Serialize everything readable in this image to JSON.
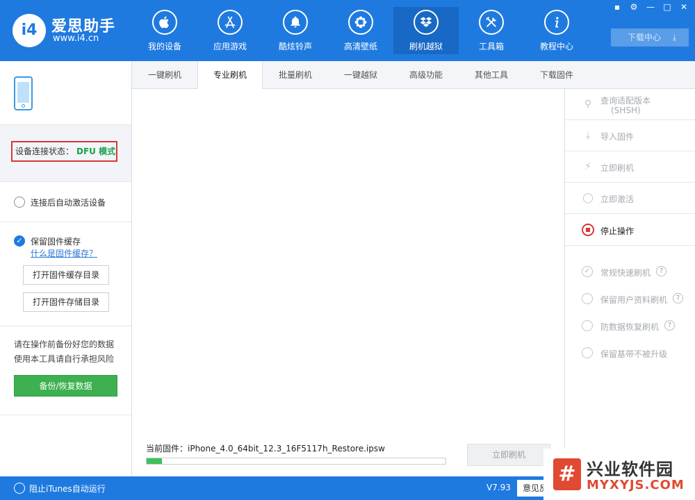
{
  "app": {
    "logo_mark": "i4",
    "title": "爱思助手",
    "url": "www.i4.cn"
  },
  "nav": [
    {
      "label": "我的设备",
      "icon": "apple-icon"
    },
    {
      "label": "应用游戏",
      "icon": "app-store-icon"
    },
    {
      "label": "酷炫铃声",
      "icon": "bell-icon"
    },
    {
      "label": "高清壁纸",
      "icon": "flower-icon"
    },
    {
      "label": "刷机越狱",
      "icon": "dropbox-icon",
      "active": true
    },
    {
      "label": "工具箱",
      "icon": "tools-icon"
    },
    {
      "label": "教程中心",
      "icon": "info-icon"
    }
  ],
  "window": {
    "download_center": "下载中心"
  },
  "left": {
    "status_label": "设备连接状态：",
    "status_value": "DFU 模式",
    "auto_activate": "连接后自动激活设备",
    "keep_cache": "保留固件缓存",
    "what_is_cache": "什么是固件缓存？",
    "open_cache_dir": "打开固件缓存目录",
    "open_storage_dir": "打开固件存储目录",
    "warning_line1": "请在操作前备份好您的数据",
    "warning_line2": "使用本工具请自行承担风险",
    "backup_button": "备份/恢复数据"
  },
  "tabs": [
    {
      "label": "一键刷机"
    },
    {
      "label": "专业刷机",
      "active": true
    },
    {
      "label": "批量刷机"
    },
    {
      "label": "一键越狱"
    },
    {
      "label": "高级功能"
    },
    {
      "label": "其他工具"
    },
    {
      "label": "下载固件"
    }
  ],
  "main": {
    "firmware_label": "当前固件：iPhone_4.0_64bit_12.3_16F5117h_Restore.ipsw",
    "progress": 0.05,
    "flash_now_button": "立即刷机"
  },
  "right": {
    "query_shsh_line1": "查询适配版本",
    "query_shsh_line2": "(SHSH)",
    "import_firmware": "导入固件",
    "flash_now": "立即刷机",
    "activate_now": "立即激活",
    "stop": "停止操作",
    "opt_fast": "常规快速刷机",
    "opt_keep_data": "保留用户资料刷机",
    "opt_anti_recovery": "防数据恢复刷机",
    "opt_keep_baseband": "保留基带不被升级"
  },
  "bottom": {
    "block_itunes": "阻止iTunes自动运行",
    "version": "V7.93",
    "feedback": "意见反"
  },
  "watermark": {
    "title": "兴业软件园",
    "url": "MYXYJS.COM"
  },
  "colors": {
    "brand_blue": "#1f7ae0",
    "status_green": "#16a34a",
    "backup_green": "#3db04f",
    "alert_red": "#d9363a"
  }
}
